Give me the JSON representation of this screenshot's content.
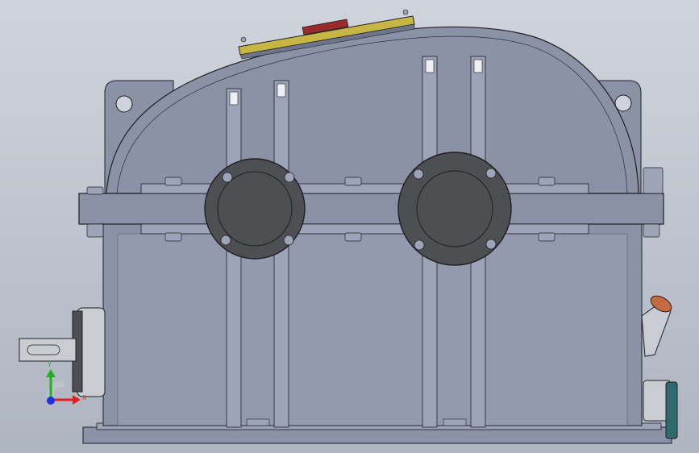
{
  "viewport": {
    "background_top": "#cfd4dc",
    "background_bottom": "#aeb5c0"
  },
  "model": {
    "body_color": "#8c92a6",
    "body_dark": "#6f7588",
    "body_light": "#9ea4b8",
    "cover_color": "#4e4f52",
    "edge_color": "#1e1f24",
    "shaft_color": "#c9ccd2",
    "breather_color": "#c66a40",
    "gauge_color": "#c7b544",
    "plug_color": "#2f6b6e"
  },
  "triad": {
    "x_label": "X",
    "y_label": "Y",
    "x_color": "#e02020",
    "y_color": "#20b020",
    "z_color": "#2030e0"
  }
}
